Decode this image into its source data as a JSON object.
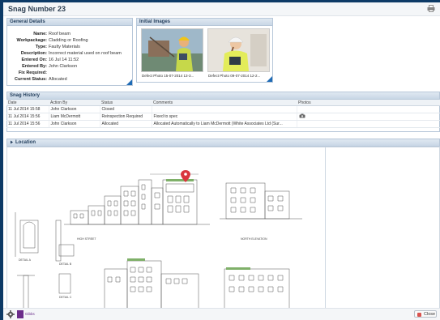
{
  "window": {
    "title": "Snag Number 23"
  },
  "general": {
    "heading": "General Details",
    "rows": [
      {
        "label": "Name:",
        "value": "Roof beam"
      },
      {
        "label": "Workpackage:",
        "value": "Cladding or Roofing"
      },
      {
        "label": "Type:",
        "value": "Faulty Materials"
      },
      {
        "label": "Description:",
        "value": "Incorrect material used on roof beam"
      },
      {
        "label": "Entered On:",
        "value": "16 Jul 14 11:52"
      },
      {
        "label": "Entered By:",
        "value": "John Clarkson"
      },
      {
        "label": "Fix Required:",
        "value": ""
      },
      {
        "label": "Current Status:",
        "value": "Allocated"
      }
    ]
  },
  "images": {
    "heading": "Initial Images",
    "items": [
      {
        "caption": "Defect Photo 15-07-2014 13-3..."
      },
      {
        "caption": "Defect Photo 09-07-2014 12-2..."
      }
    ]
  },
  "history": {
    "heading": "Snag History",
    "columns": [
      "Date",
      "Action By",
      "Status",
      "Comments",
      "Photos"
    ],
    "rows": [
      {
        "date": "11 Jul 2014 15:58",
        "by": "John Clarkson",
        "status": "Closed",
        "comment": "",
        "photo": false
      },
      {
        "date": "11 Jul 2014 15:56",
        "by": "Liam McDermott",
        "status": "Reinspection Required",
        "comment": "Fixed to spec",
        "photo": true
      },
      {
        "date": "11 Jul 2014 15:56",
        "by": "John Clarkson",
        "status": "Allocated",
        "comment": "Allocated Automatically to Liam McDermott (White Associates Ltd (Sur...",
        "photo": false
      }
    ]
  },
  "location": {
    "heading": "Location",
    "labels": {
      "street": "HIGH STREET",
      "north": "NORTH ELEVATION",
      "detail_a": "DETAIL A",
      "detail_b": "DETAIL B",
      "detail_c": "DETAIL C"
    }
  },
  "footer": {
    "close_label": "Close",
    "brand": "Gibbs"
  },
  "colors": {
    "accent": "#1f6bb5",
    "pin": "#d9363e",
    "roof": "#7fb069"
  }
}
